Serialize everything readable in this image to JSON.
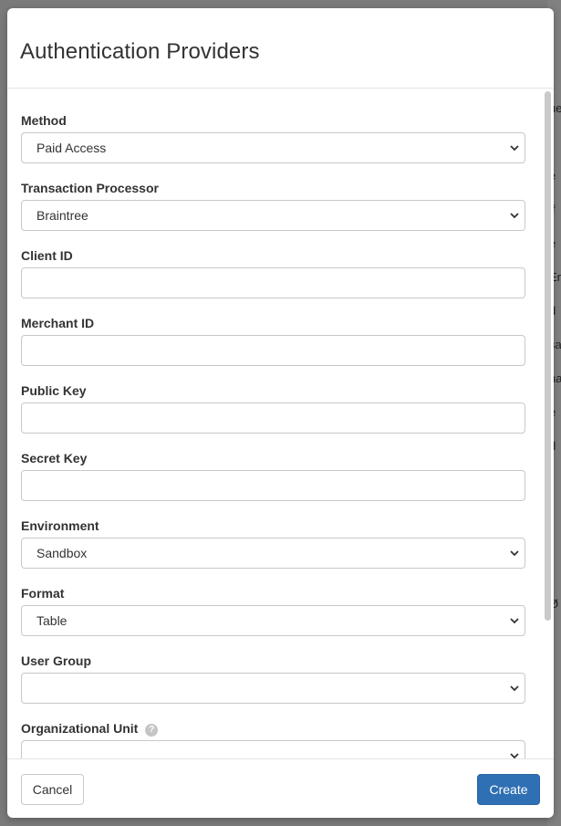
{
  "modal": {
    "title": "Authentication Providers"
  },
  "form": {
    "method": {
      "label": "Method",
      "value": "Paid Access"
    },
    "transaction_processor": {
      "label": "Transaction Processor",
      "value": "Braintree"
    },
    "client_id": {
      "label": "Client ID",
      "value": ""
    },
    "merchant_id": {
      "label": "Merchant ID",
      "value": ""
    },
    "public_key": {
      "label": "Public Key",
      "value": ""
    },
    "secret_key": {
      "label": "Secret Key",
      "value": ""
    },
    "environment": {
      "label": "Environment",
      "value": "Sandbox"
    },
    "format": {
      "label": "Format",
      "value": "Table"
    },
    "user_group": {
      "label": "User Group",
      "value": ""
    },
    "organizational_unit": {
      "label": "Organizational Unit",
      "value": "",
      "help_icon": "question-circle-icon"
    }
  },
  "footer": {
    "cancel_label": "Cancel",
    "create_label": "Create"
  },
  "background": {
    "fragments": [
      "ue",
      "-",
      "e",
      "if",
      "e",
      "En",
      "d",
      "sa",
      "na",
      "e",
      "d",
      "Ø"
    ]
  },
  "colors": {
    "primary": "#2f6fb3",
    "overlay": "#7a7a7a"
  }
}
